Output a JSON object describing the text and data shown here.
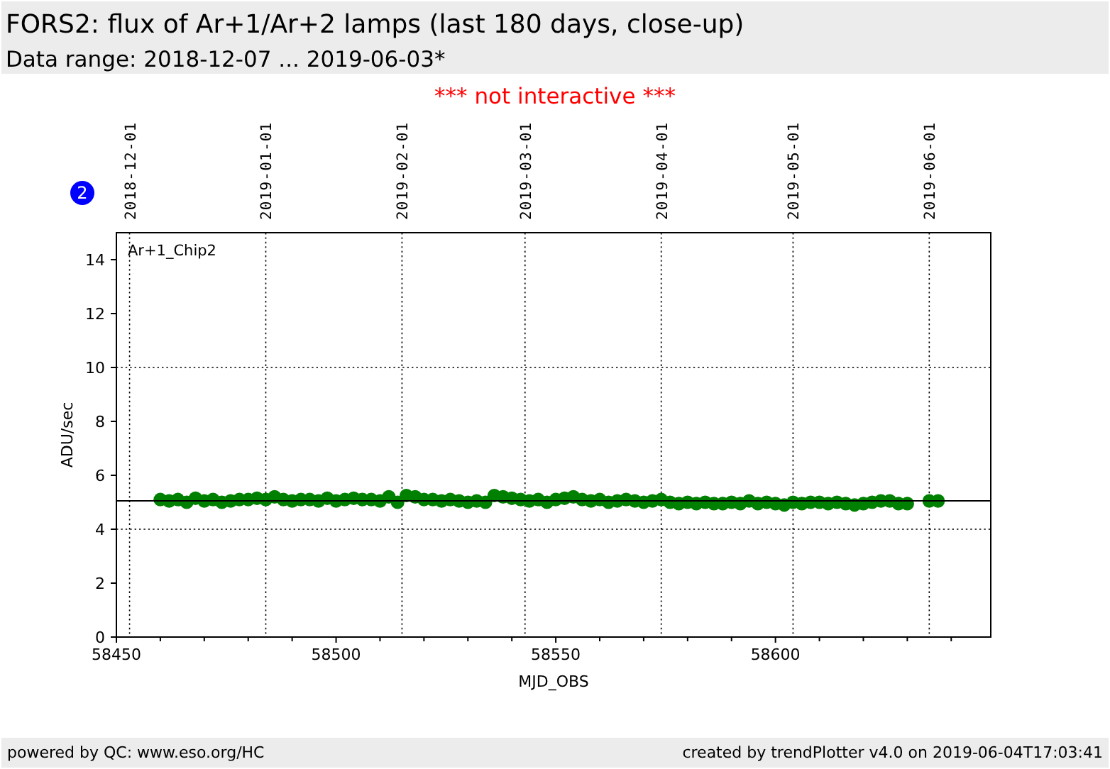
{
  "header": {
    "title": "FORS2: flux of Ar+1/Ar+2 lamps (last 180 days, close-up)",
    "subtitle": "Data range: 2018-12-07 ... 2019-06-03*"
  },
  "notice": "*** not interactive ***",
  "plot": {
    "badge": "2",
    "chart_data": {
      "type": "scatter",
      "xlabel": "MJD_OBS",
      "ylabel": "ADU/sec",
      "xlim": [
        58450,
        58649
      ],
      "ylim": [
        0,
        15
      ],
      "xticks": [
        58450,
        58500,
        58550,
        58600
      ],
      "yticks": [
        0,
        2,
        4,
        6,
        8,
        10,
        12,
        14
      ],
      "x": [
        58460,
        58462,
        58464,
        58466,
        58468,
        58470,
        58472,
        58474,
        58476,
        58478,
        58480,
        58482,
        58484,
        58486,
        58488,
        58490,
        58492,
        58494,
        58496,
        58498,
        58500,
        58502,
        58504,
        58506,
        58508,
        58510,
        58512,
        58514,
        58516,
        58518,
        58520,
        58522,
        58524,
        58526,
        58528,
        58530,
        58532,
        58534,
        58536,
        58538,
        58540,
        58542,
        58544,
        58546,
        58548,
        58550,
        58552,
        58554,
        58556,
        58558,
        58560,
        58562,
        58564,
        58566,
        58568,
        58570,
        58572,
        58574,
        58576,
        58578,
        58580,
        58582,
        58584,
        58586,
        58588,
        58590,
        58592,
        58594,
        58596,
        58598,
        58600,
        58602,
        58604,
        58606,
        58608,
        58610,
        58612,
        58614,
        58616,
        58618,
        58620,
        58622,
        58624,
        58626,
        58628,
        58630,
        58635,
        58637
      ],
      "series": [
        {
          "name": "Ar+1_Chip2",
          "color": "#008000",
          "values": [
            5.1,
            5.05,
            5.1,
            5.0,
            5.15,
            5.05,
            5.1,
            5.0,
            5.05,
            5.1,
            5.1,
            5.15,
            5.1,
            5.2,
            5.1,
            5.05,
            5.1,
            5.1,
            5.05,
            5.15,
            5.05,
            5.1,
            5.15,
            5.1,
            5.1,
            5.05,
            5.2,
            5.0,
            5.25,
            5.2,
            5.1,
            5.1,
            5.05,
            5.1,
            5.05,
            5.0,
            5.05,
            5.0,
            5.25,
            5.2,
            5.15,
            5.1,
            5.05,
            5.1,
            5.0,
            5.1,
            5.15,
            5.2,
            5.1,
            5.05,
            5.1,
            5.0,
            5.05,
            5.1,
            5.05,
            5.0,
            5.05,
            5.1,
            5.0,
            4.95,
            5.0,
            4.95,
            5.0,
            4.95,
            4.95,
            5.0,
            4.95,
            5.05,
            4.95,
            5.0,
            4.95,
            4.9,
            5.0,
            4.95,
            5.0,
            5.0,
            4.95,
            5.0,
            4.95,
            4.9,
            4.95,
            5.0,
            5.05,
            5.05,
            4.95,
            4.95,
            5.05,
            5.05
          ]
        }
      ],
      "ref_lines": [
        {
          "axis": "y",
          "value": 5.05
        },
        {
          "axis": "y",
          "value": 4
        },
        {
          "axis": "y",
          "value": 10
        }
      ],
      "annotations": [
        "2018-12-01",
        "2019-01-01",
        "2019-02-01",
        "2019-03-01",
        "2019-04-01",
        "2019-05-01",
        "2019-06-01"
      ]
    }
  },
  "footer": {
    "left": "powered by QC: www.eso.org/HC",
    "right": "created by trendPlotter v4.0 on 2019-06-04T17:03:41"
  }
}
